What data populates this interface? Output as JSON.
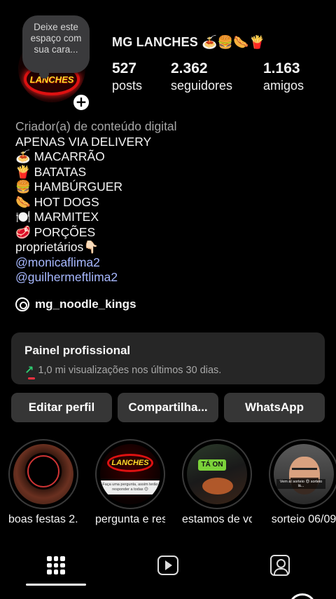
{
  "profile": {
    "note": "Deixe este espaço com sua cara...",
    "avatar_text": "LANCHES",
    "name": "MG LANCHES 🍝🍔🌭🍟",
    "stats": [
      {
        "value": "527",
        "label": "posts"
      },
      {
        "value": "2.362",
        "label": "seguidores"
      },
      {
        "value": "1.163",
        "label": "amigos"
      }
    ]
  },
  "bio": {
    "category": "Criador(a) de conteúdo digital",
    "lines": [
      "APENAS VIA DELIVERY",
      "🍝 MACARRÃO",
      "🍟 BATATAS",
      "🍔 HAMBÚRGUER",
      "🌭 HOT DOGS",
      "🍽️ MARMITEX",
      "🥩 PORÇÕES",
      "proprietários👇🏻"
    ],
    "links": [
      "@monicaflima2",
      "@guilhermeftlima2"
    ],
    "threads_handle": "mg_noodle_kings"
  },
  "pro_panel": {
    "title": "Painel profissional",
    "stats": "1,0 mi visualizações nos últimos 30 dias.",
    "trend_symbol": "↗"
  },
  "buttons": {
    "edit": "Editar perfil",
    "share": "Compartilha...",
    "whatsapp": "WhatsApp"
  },
  "highlights": [
    {
      "label": "boas festas 2..."
    },
    {
      "label": "pergunta e res"
    },
    {
      "label": "estamos de vo..."
    },
    {
      "label": "sorteio 06/09"
    }
  ],
  "highlight_art": {
    "logo": "LANCHES",
    "strip": "Faça uma pergunta, assim terão responder a todas 😊",
    "tag": "TÁ ON",
    "caption": "Vem aí sorteio 😍 sorteio lá..."
  },
  "tabs": [
    {
      "icon": "grid-icon",
      "active": true
    },
    {
      "icon": "reels-icon",
      "active": false
    },
    {
      "icon": "tagged-icon",
      "active": false
    }
  ],
  "colors": {
    "background": "#000000",
    "panel": "#262626",
    "button": "#363636",
    "link": "#a7b8ff",
    "trend": "#2ecc71"
  }
}
